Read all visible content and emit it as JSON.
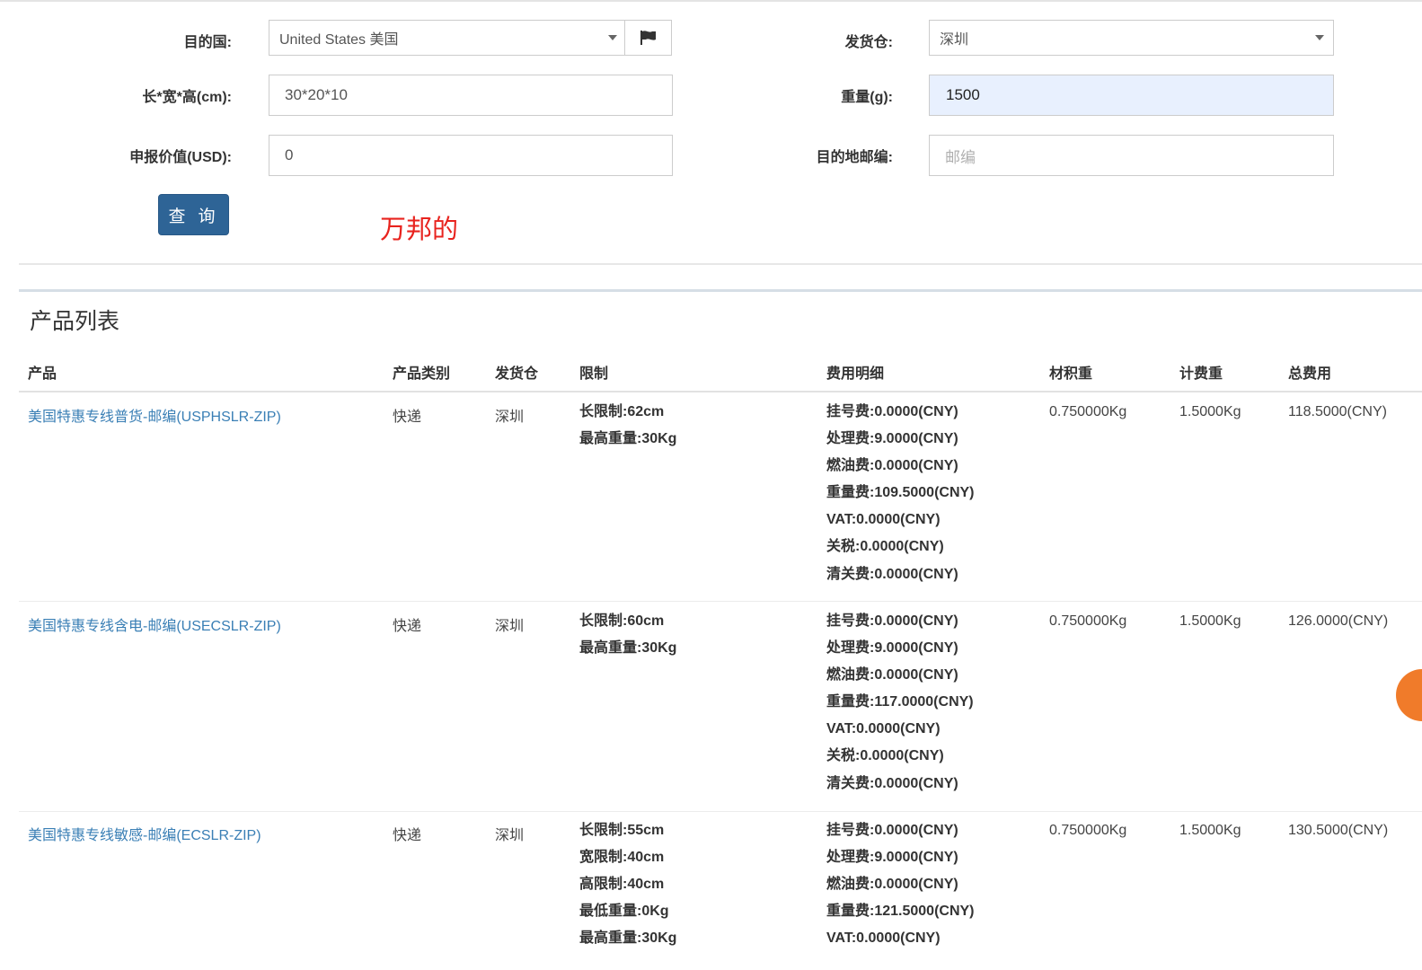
{
  "form": {
    "destination": {
      "label": "目的国:",
      "value": "United States 美国"
    },
    "warehouse": {
      "label": "发货仓:",
      "value": "深圳"
    },
    "dimensions": {
      "label": "长*宽*高(cm):",
      "value": "30*20*10"
    },
    "weight": {
      "label": "重量(g):",
      "value": "1500"
    },
    "declared_value": {
      "label": "申报价值(USD):",
      "value": "0"
    },
    "postcode": {
      "label": "目的地邮编:",
      "placeholder": "邮编"
    },
    "query_button": "查 询",
    "annotation": "万邦的"
  },
  "product_list": {
    "title": "产品列表",
    "columns": [
      "产品",
      "产品类别",
      "发货仓",
      "限制",
      "费用明细",
      "材积重",
      "计费重",
      "总费用"
    ],
    "rows": [
      {
        "product": "美国特惠专线普货-邮编(USPHSLR-ZIP)",
        "category": "快递",
        "warehouse": "深圳",
        "limits": [
          "长限制:62cm",
          "最高重量:30Kg"
        ],
        "fees": [
          "挂号费:0.0000(CNY)",
          "处理费:9.0000(CNY)",
          "燃油费:0.0000(CNY)",
          "重量费:109.5000(CNY)",
          "VAT:0.0000(CNY)",
          "关税:0.0000(CNY)",
          "清关费:0.0000(CNY)"
        ],
        "volume_weight": "0.750000Kg",
        "charge_weight": "1.5000Kg",
        "total": "118.5000(CNY)"
      },
      {
        "product": "美国特惠专线含电-邮编(USECSLR-ZIP)",
        "category": "快递",
        "warehouse": "深圳",
        "limits": [
          "长限制:60cm",
          "最高重量:30Kg"
        ],
        "fees": [
          "挂号费:0.0000(CNY)",
          "处理费:9.0000(CNY)",
          "燃油费:0.0000(CNY)",
          "重量费:117.0000(CNY)",
          "VAT:0.0000(CNY)",
          "关税:0.0000(CNY)",
          "清关费:0.0000(CNY)"
        ],
        "volume_weight": "0.750000Kg",
        "charge_weight": "1.5000Kg",
        "total": "126.0000(CNY)"
      },
      {
        "product": "美国特惠专线敏感-邮编(ECSLR-ZIP)",
        "category": "快递",
        "warehouse": "深圳",
        "limits": [
          "长限制:55cm",
          "宽限制:40cm",
          "高限制:40cm",
          "最低重量:0Kg",
          "最高重量:30Kg"
        ],
        "fees": [
          "挂号费:0.0000(CNY)",
          "处理费:9.0000(CNY)",
          "燃油费:0.0000(CNY)",
          "重量费:121.5000(CNY)",
          "VAT:0.0000(CNY)"
        ],
        "volume_weight": "0.750000Kg",
        "charge_weight": "1.5000Kg",
        "total": "130.5000(CNY)"
      }
    ]
  },
  "icons": {
    "flag_button": "flag-icon",
    "select_caret": "caret-down-icon",
    "floating_chat": "chat-bubble-icon"
  },
  "colors": {
    "primary_button": "#2e6496",
    "link": "#3a7fb5",
    "annotation": "#e8231e",
    "autofill": "#e8f0fe"
  }
}
